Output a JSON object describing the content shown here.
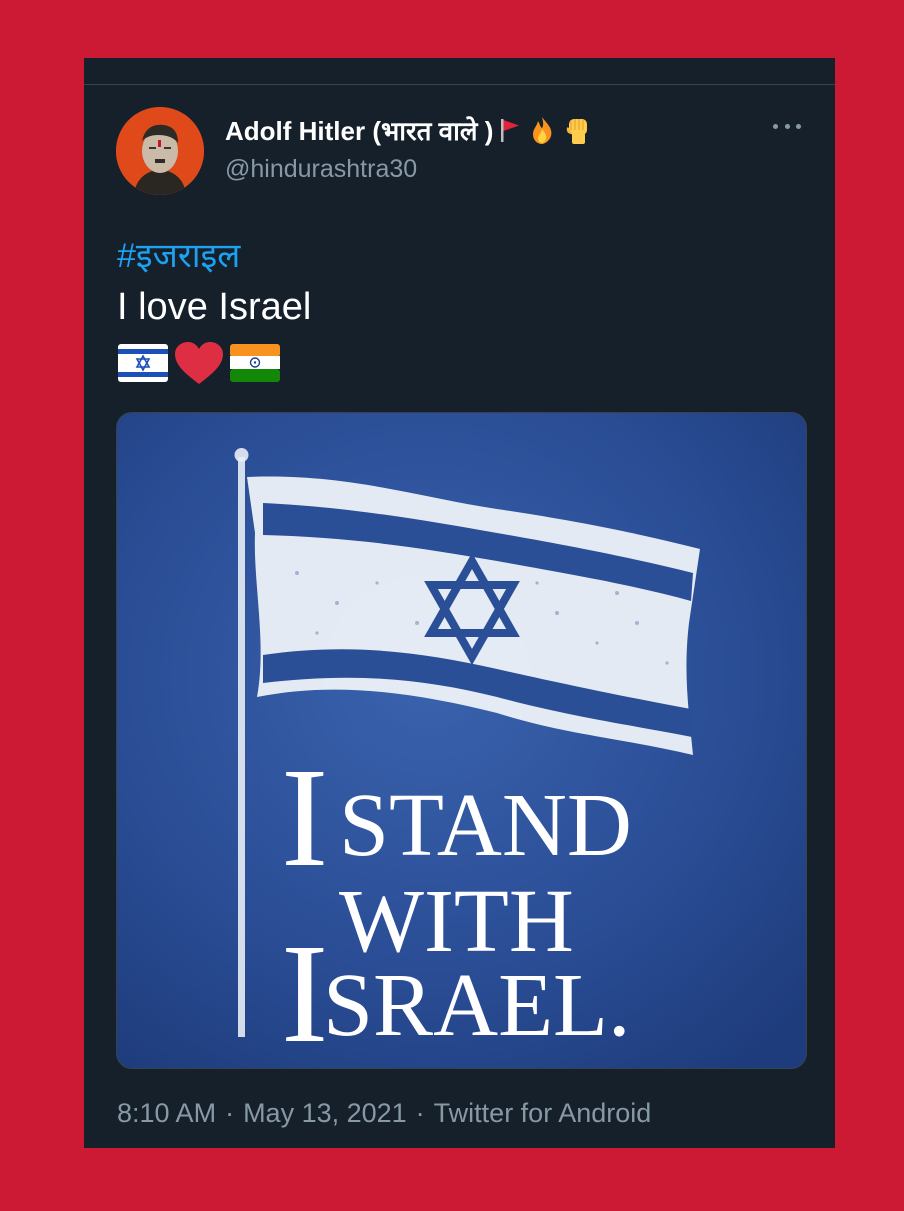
{
  "tweet": {
    "display_name": "Adolf Hitler (भारत वाले )",
    "handle": "@hindurashtra30",
    "name_icons": [
      "red-flag-icon",
      "fire-icon",
      "raised-fist-icon"
    ],
    "hashtag": "#इजराइल",
    "text": "I love Israel",
    "emoji": [
      "israel-flag-icon",
      "red-heart-icon",
      "india-flag-icon"
    ],
    "time": "8:10 AM",
    "date": "May 13, 2021",
    "source": "Twitter for Android",
    "separator": "·"
  },
  "media": {
    "line1_big": "I",
    "line1": "STAND",
    "line2": "WITH",
    "line3_big": "I",
    "line3": "SRAEL."
  },
  "colors": {
    "background": "#cc1a35",
    "card": "#15202b",
    "link": "#1da1f2",
    "secondary_text": "#8899a6",
    "image_blue": "#2b4f97"
  }
}
